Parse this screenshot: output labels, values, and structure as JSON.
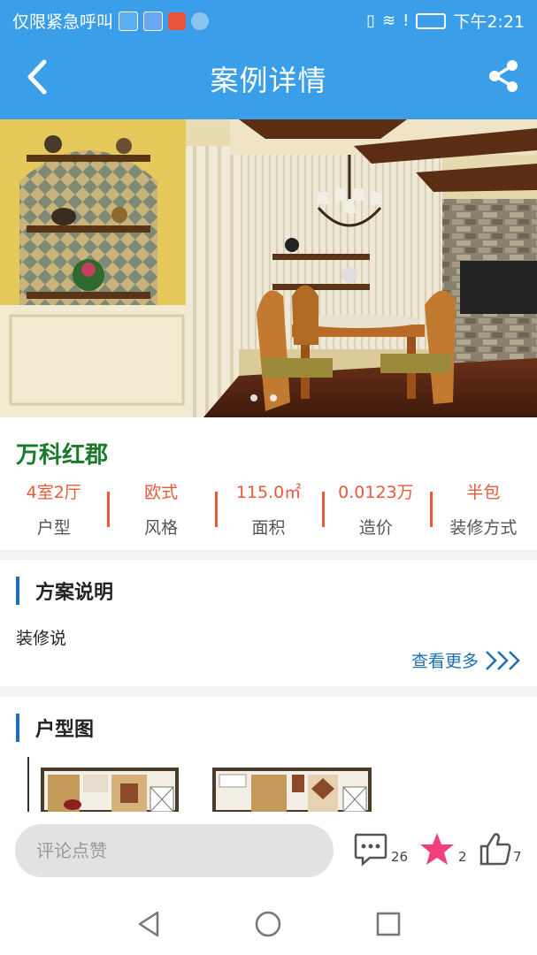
{
  "status_bar": {
    "carrier_text": "仅限紧急呼叫",
    "time": "下午2:21"
  },
  "header": {
    "title": "案例详情",
    "back_icon": "chevron-left-icon",
    "share_icon": "share-icon"
  },
  "hero": {
    "carousel_total": 2,
    "carousel_active": 1
  },
  "project": {
    "name": "万科红郡",
    "stats": [
      {
        "value": "4室2厅",
        "label": "户型"
      },
      {
        "value": "欧式",
        "label": "风格"
      },
      {
        "value": "115.0㎡",
        "label": "面积"
      },
      {
        "value": "0.0123万",
        "label": "造价"
      },
      {
        "value": "半包",
        "label": "装修方式"
      }
    ]
  },
  "description": {
    "title": "方案说明",
    "text": "装修说",
    "more_label": "查看更多"
  },
  "floorplan": {
    "title": "户型图"
  },
  "actions": {
    "comment_placeholder": "评论点赞",
    "comment_count": "26",
    "favorite_count": "2",
    "like_count": "7"
  },
  "colors": {
    "header_blue": "#3a9ee8",
    "accent_orange": "#e85a3a",
    "name_green": "#1a7a2a",
    "link_blue": "#1e6fb5",
    "favorite_pink": "#f0407a"
  }
}
